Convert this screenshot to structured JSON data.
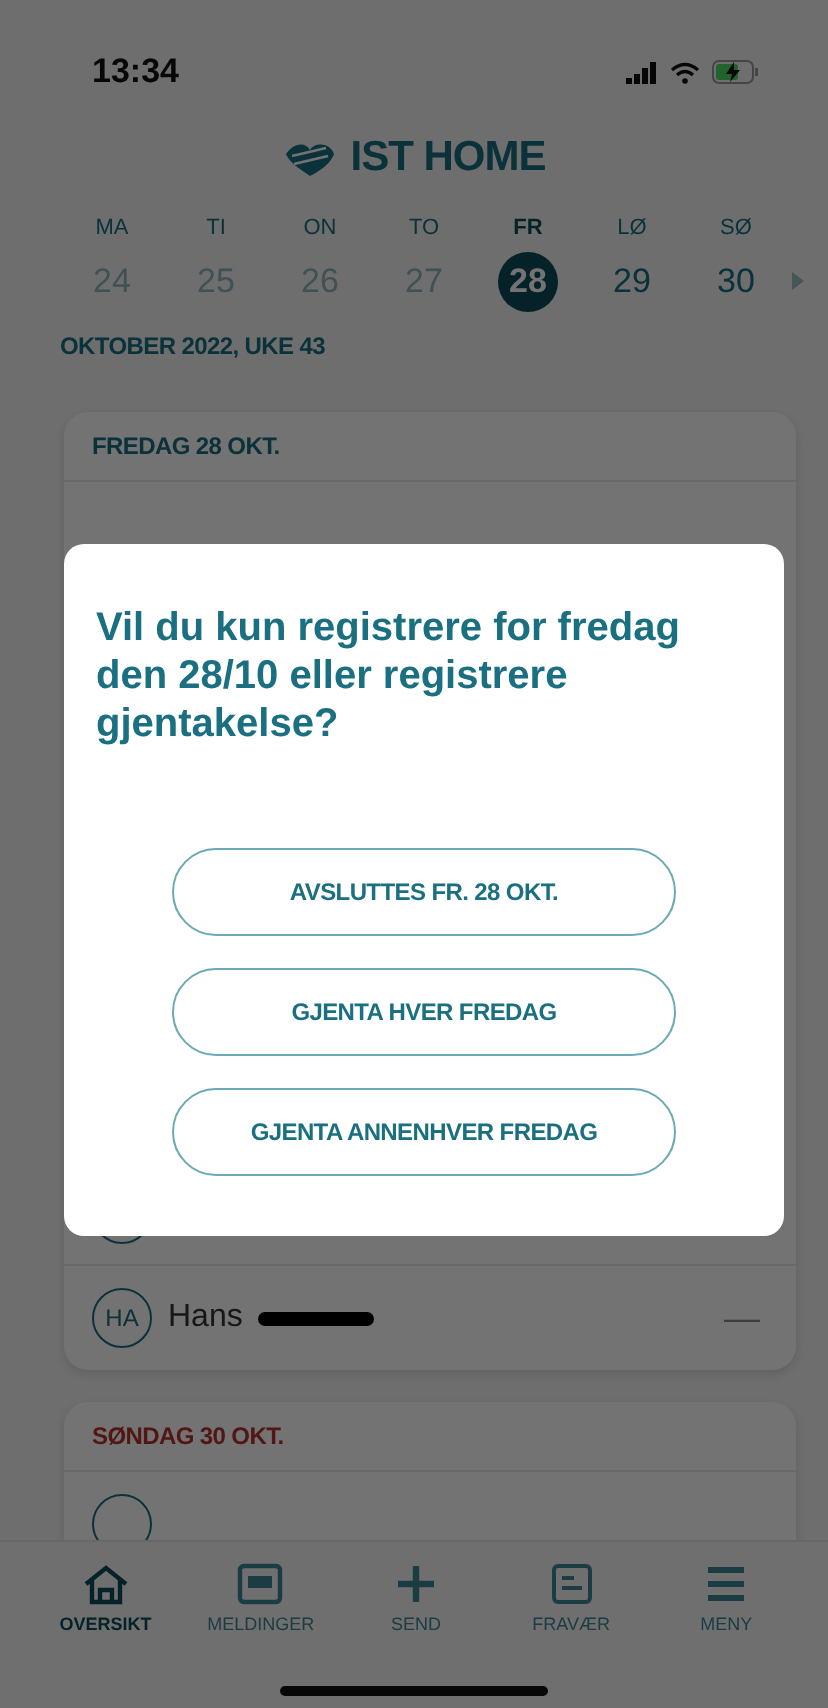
{
  "status_bar": {
    "time": "13:34"
  },
  "header": {
    "title": "IST HOME"
  },
  "week": {
    "days": [
      {
        "weekday": "MA",
        "date": "24",
        "past": true,
        "selected": false
      },
      {
        "weekday": "TI",
        "date": "25",
        "past": true,
        "selected": false
      },
      {
        "weekday": "ON",
        "date": "26",
        "past": true,
        "selected": false
      },
      {
        "weekday": "TO",
        "date": "27",
        "past": true,
        "selected": false
      },
      {
        "weekday": "FR",
        "date": "28",
        "past": false,
        "selected": true
      },
      {
        "weekday": "LØ",
        "date": "29",
        "past": false,
        "selected": false
      },
      {
        "weekday": "SØ",
        "date": "30",
        "past": false,
        "selected": false
      }
    ],
    "label": "OKTOBER 2022, UKE 43"
  },
  "cards": [
    {
      "title": "FREDAG 28 OKT.",
      "holiday": false,
      "rows": [
        {
          "initials": "",
          "name": ""
        },
        {
          "initials": "HA",
          "name": "Hans",
          "redacted": true,
          "status": "—"
        }
      ]
    },
    {
      "title": "SØNDAG 30 OKT.",
      "holiday": true,
      "rows": [
        {
          "initials": "",
          "name": ""
        }
      ]
    }
  ],
  "dialog": {
    "question": "Vil du kun registrere for fredag den 28/10 eller registrere gjentakelse?",
    "buttons": [
      "AVSLUTTES FR. 28 OKT.",
      "GJENTA HVER FREDAG",
      "GJENTA ANNENHVER FREDAG"
    ]
  },
  "nav": [
    {
      "kind": "home",
      "label": "OVERSIKT",
      "selected": true
    },
    {
      "kind": "messages",
      "label": "MELDINGER",
      "selected": false
    },
    {
      "kind": "plus",
      "label": "SEND",
      "selected": false
    },
    {
      "kind": "form",
      "label": "FRAVÆR",
      "selected": false
    },
    {
      "kind": "menu",
      "label": "MENY",
      "selected": false
    }
  ]
}
